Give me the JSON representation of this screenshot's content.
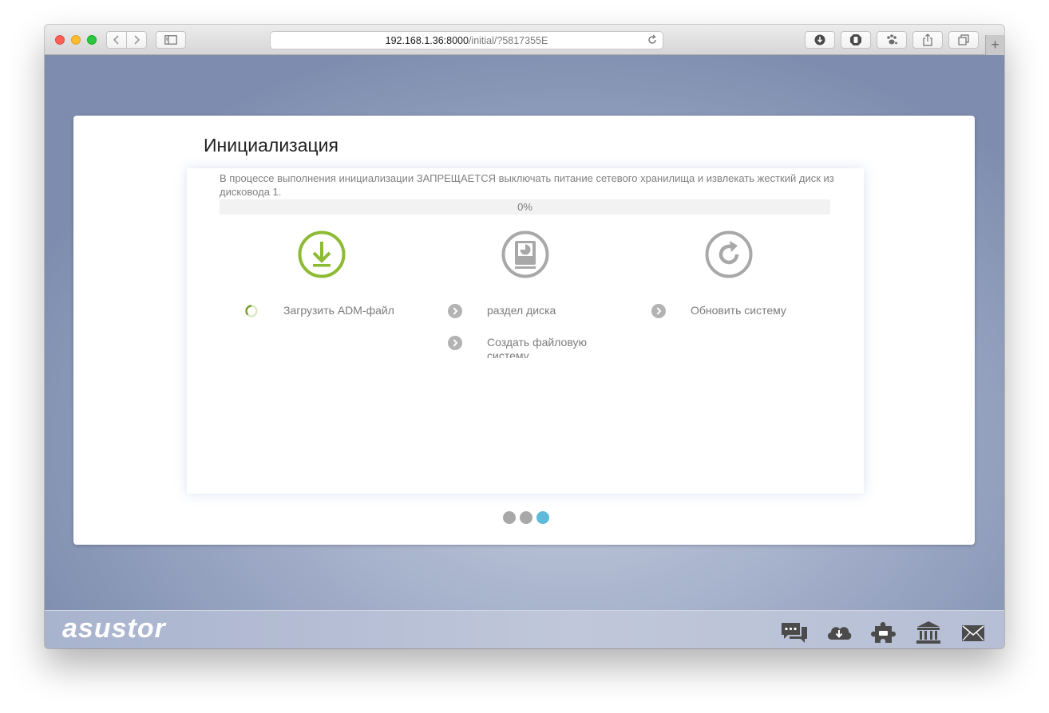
{
  "browser": {
    "url_host": "192.168.1.36:8000",
    "url_path": "/initial/?5817355E"
  },
  "init": {
    "title": "Инициализация",
    "warning": "В процессе выполнения инициализации ЗАПРЕЩАЕТСЯ выключать питание сетевого хранилища и извлекать жесткий диск из дисковода 1.",
    "progress": {
      "label": "0%",
      "value": 0
    },
    "steps": [
      {
        "label": "Загрузить ADM-файл",
        "status": "in-progress",
        "icon": "download-icon"
      },
      {
        "label": "раздел диска",
        "status": "pending",
        "icon": "disk-partition-icon"
      },
      {
        "label": "Создать файловую систему",
        "status": "pending",
        "icon": "disk-partition-icon"
      },
      {
        "label": "Обновить систему",
        "status": "pending",
        "icon": "refresh-icon"
      }
    ],
    "pager": {
      "count": 3,
      "active": 3
    }
  },
  "footer": {
    "logo": "asustor",
    "icons": [
      "chat-icon",
      "cloud-download-icon",
      "puzzle-icon",
      "bank-icon",
      "mail-icon"
    ]
  },
  "colors": {
    "accent_green": "#8dbb33",
    "inactive_gray": "#a8a8a8",
    "pager_active": "#5dbad9"
  }
}
